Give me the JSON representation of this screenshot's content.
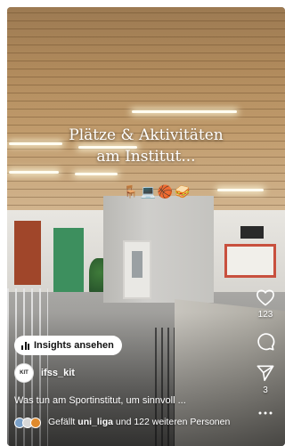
{
  "reel": {
    "overlay_text_line1": "Plätze & Aktivitäten",
    "overlay_text_line2": "am Institut...",
    "overlay_emojis": [
      "🪑",
      "💻",
      "🏀",
      "🥪"
    ]
  },
  "insights_button_label": "Insights ansehen",
  "account": {
    "username": "ifss_kit",
    "avatar_text": "KIT"
  },
  "caption": "Was tun am Sportinstitut, um sinnvoll ...",
  "likes": {
    "prefix": "Gefällt",
    "liked_by": "uni_liga",
    "suffix": "und 122 weiteren Personen"
  },
  "actions": {
    "like_icon": "heart-icon",
    "like_count": "123",
    "comment_icon": "comment-icon",
    "share_icon": "send-icon",
    "share_count": "3",
    "more_icon": "more-icon"
  },
  "colors": {
    "text": "#ffffff",
    "button_bg": "#ffffff",
    "ceiling_wood": "#b08a5c"
  }
}
